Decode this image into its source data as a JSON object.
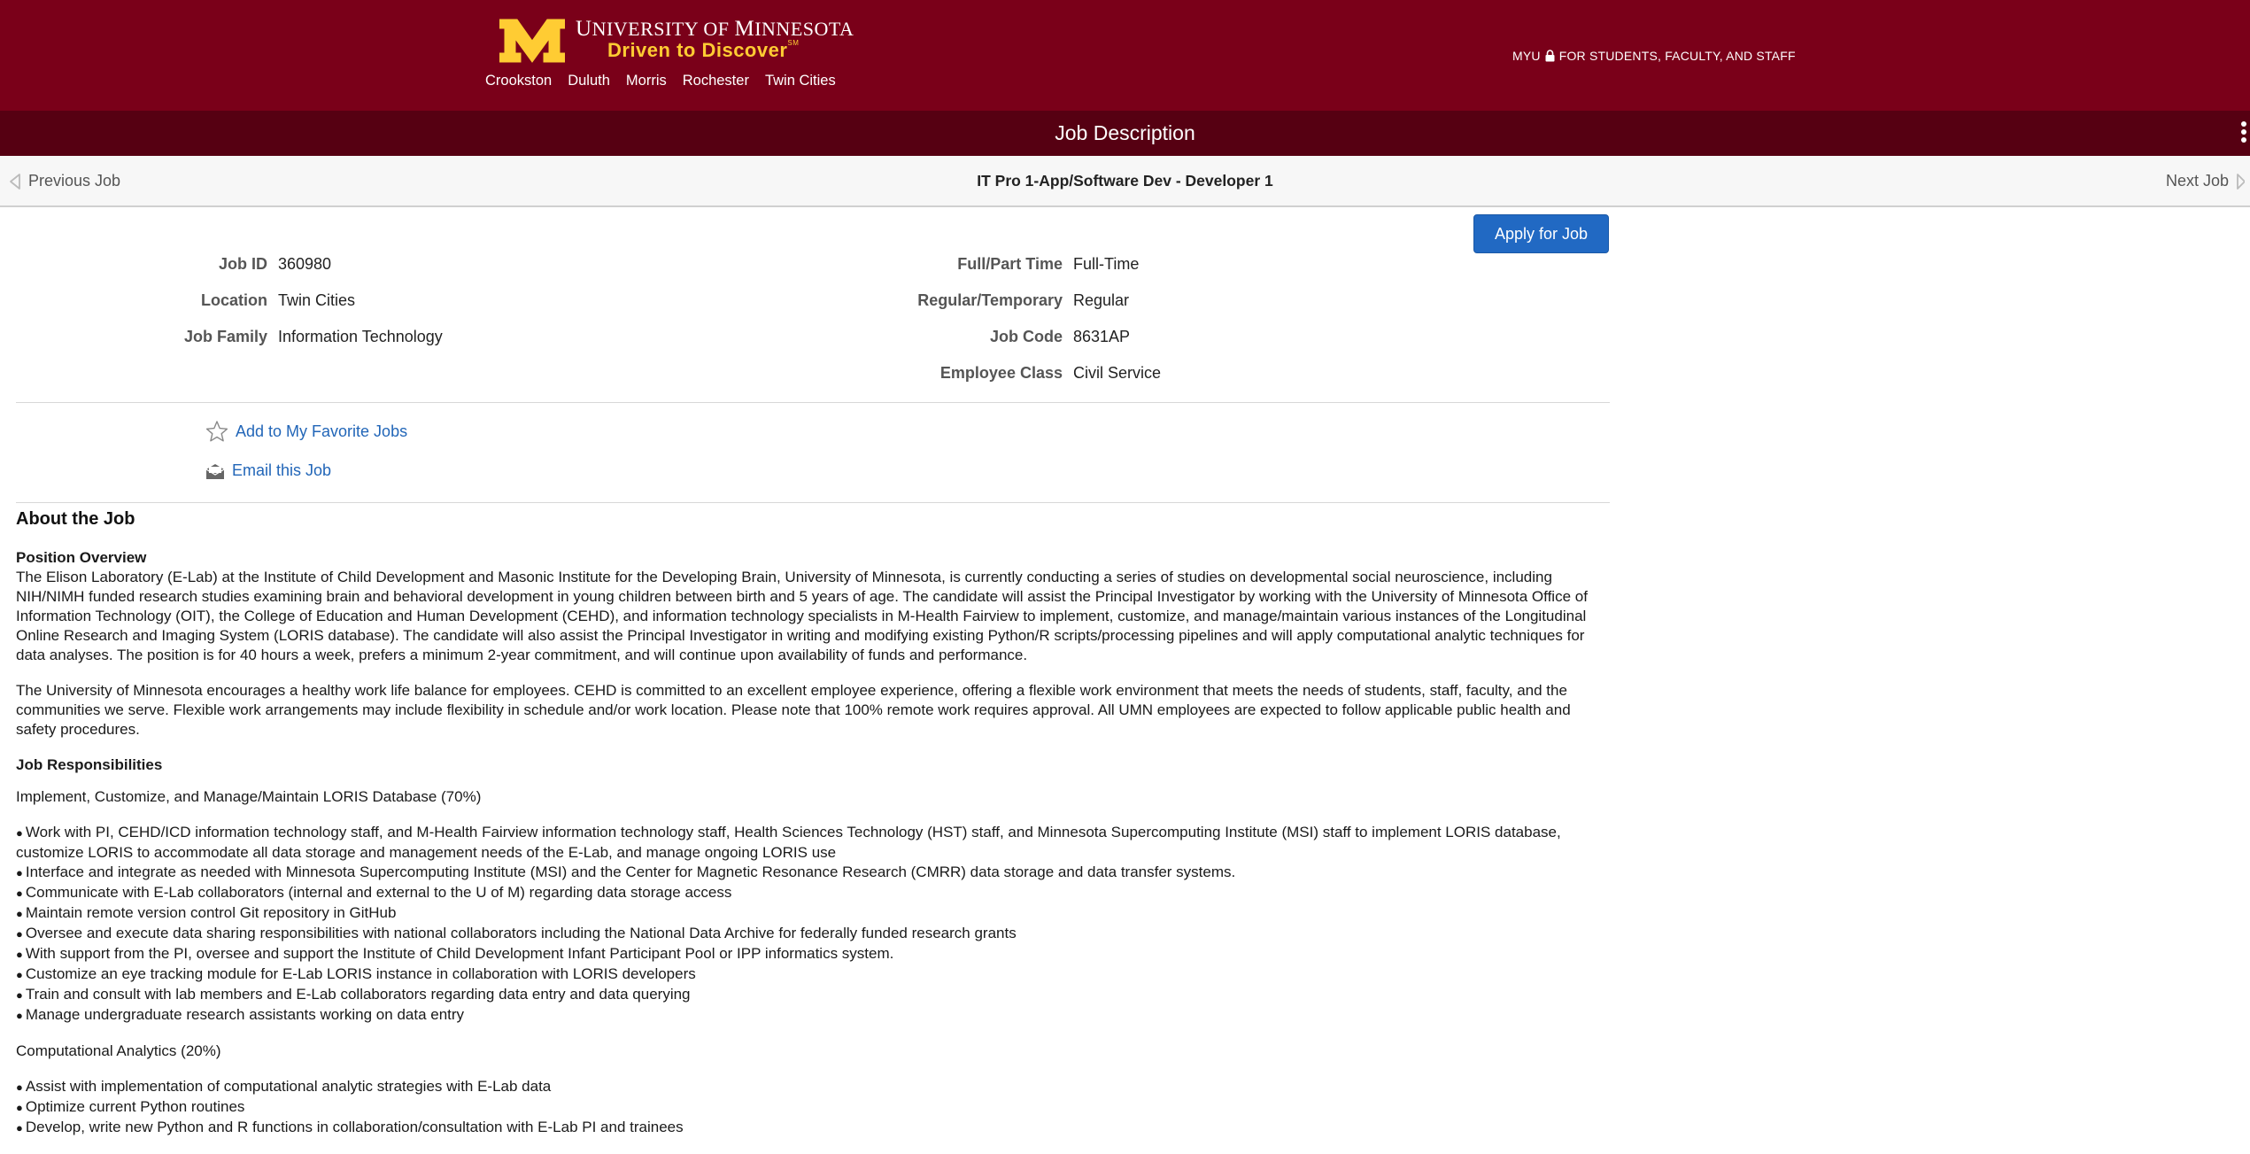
{
  "header": {
    "university_title_prefix": "U",
    "university_title_rest": "NIVERSITY OF ",
    "university_title_prefix2": "M",
    "university_title_rest2": "INNESOTA",
    "tagline": "Driven to Discover",
    "tagline_mark": "SM",
    "campuses": [
      "Crookston",
      "Duluth",
      "Morris",
      "Rochester",
      "Twin Cities"
    ],
    "myu_label": "MYU",
    "myu_suffix": "FOR STUDENTS, FACULTY, AND STAFF",
    "brand_maroon": "#7a0019",
    "brand_gold": "#ffcc33"
  },
  "title_bar": {
    "title": "Job Description"
  },
  "job_nav": {
    "previous_label": "Previous Job",
    "next_label": "Next Job",
    "job_title": "IT Pro 1-App/Software Dev - Developer 1"
  },
  "apply_button": "Apply for Job",
  "details_left": [
    {
      "label": "Job ID",
      "value": "360980"
    },
    {
      "label": "Location",
      "value": "Twin Cities"
    },
    {
      "label": "Job Family",
      "value": "Information Technology"
    }
  ],
  "details_right": [
    {
      "label": "Full/Part Time",
      "value": "Full-Time"
    },
    {
      "label": "Regular/Temporary",
      "value": "Regular"
    },
    {
      "label": "Job Code",
      "value": "8631AP"
    },
    {
      "label": "Employee Class",
      "value": "Civil Service"
    }
  ],
  "actions": {
    "favorite": "Add to My Favorite Jobs",
    "email": "Email this Job"
  },
  "about": {
    "heading": "About the Job",
    "position_overview_title": "Position Overview",
    "position_overview": "The Elison Laboratory (E-Lab) at the Institute of Child Development and Masonic Institute for the Developing Brain, University of Minnesota, is currently conducting a series of studies on developmental social neuroscience, including NIH/NIMH funded research studies examining brain and behavioral development in young children between birth and 5 years of age. The candidate will assist the Principal Investigator by working with the University of Minnesota Office of Information Technology (OIT), the College of Education and Human Development (CEHD), and information technology specialists in M-Health Fairview to implement, customize, and manage/maintain various instances of the Longitudinal Online Research and Imaging System (LORIS database). The candidate will also assist the Principal Investigator in writing and modifying existing Python/R scripts/processing pipelines and will apply computational analytic techniques for data analyses. The position is for 40 hours a week, prefers a minimum 2-year commitment, and will continue upon availability of funds and performance.",
    "work_life": "The University of Minnesota encourages a healthy work life balance for employees. CEHD is committed to an excellent employee experience, offering a flexible work environment that meets the needs of students, staff, faculty, and the communities we serve. Flexible work arrangements may include flexibility in schedule and/or work location. Please note that 100% remote work requires approval. All UMN employees are expected to follow applicable public health and safety procedures.",
    "responsibilities_title": "Job Responsibilities",
    "section1_title": "Implement, Customize, and Manage/Maintain LORIS Database (70%)",
    "section1_items": [
      "Work with PI, CEHD/ICD information technology staff, and M-Health Fairview information technology staff, Health Sciences Technology (HST) staff, and Minnesota Supercomputing Institute (MSI) staff to implement LORIS database, customize LORIS to accommodate all data storage and management needs of the E-Lab, and manage ongoing LORIS use",
      "Interface and integrate as needed with Minnesota Supercomputing Institute (MSI) and the Center for Magnetic Resonance Research (CMRR) data storage and data transfer systems.",
      "Communicate with E-Lab collaborators (internal and external to the U of M) regarding data storage access",
      "Maintain remote version control Git repository in GitHub",
      "Oversee and execute data sharing responsibilities with national collaborators including the National Data Archive for federally funded research grants",
      "With support from the PI, oversee and support the Institute of Child Development Infant Participant Pool or IPP informatics system.",
      "Customize an eye tracking module for E-Lab LORIS instance in collaboration with LORIS developers",
      "Train and consult with lab members and E-Lab collaborators regarding data entry and data querying",
      "Manage undergraduate research assistants working on data entry"
    ],
    "section2_title": "Computational Analytics (20%)",
    "section2_items": [
      "Assist with implementation of computational analytic strategies with E-Lab data",
      "Optimize current Python routines",
      "Develop, write new Python and R functions in collaboration/consultation with E-Lab PI and trainees"
    ]
  }
}
